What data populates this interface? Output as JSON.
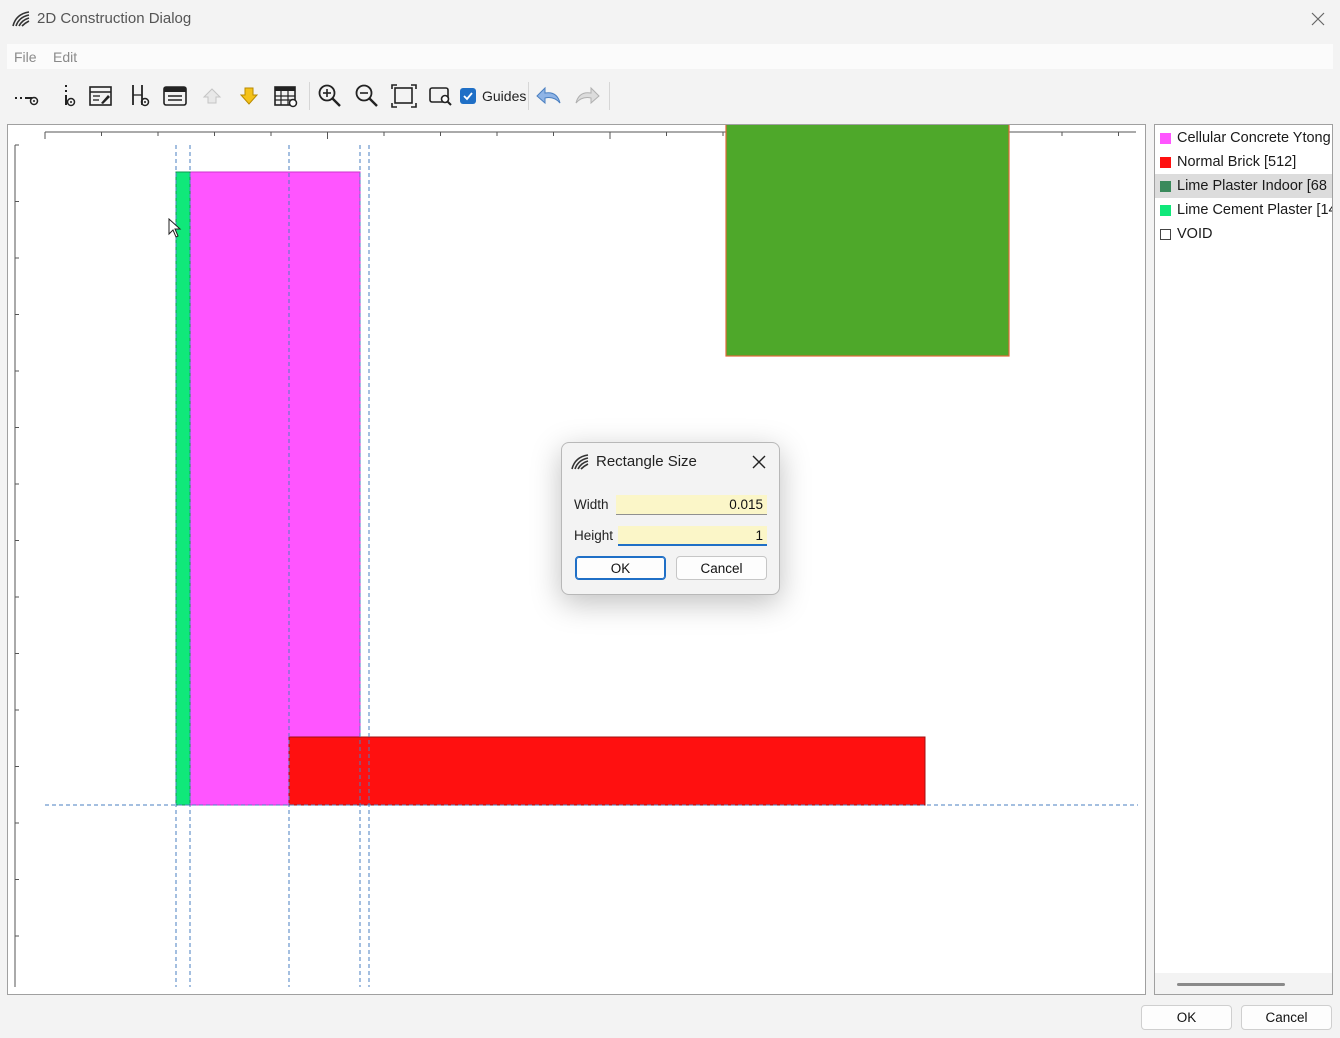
{
  "window": {
    "title": "2D Construction Dialog"
  },
  "menu": {
    "items": [
      "File",
      "Edit"
    ]
  },
  "toolbar": {
    "guides_label": "Guides",
    "guides_checked": true,
    "icons": [
      "add-horizontal-line-icon",
      "add-vertical-line-icon",
      "edit-table-icon",
      "split-icon",
      "properties-icon",
      "move-up-icon",
      "move-down-icon",
      "grid-table-icon",
      "zoom-in-icon",
      "zoom-out-icon",
      "zoom-fit-icon",
      "zoom-select-icon",
      "undo-icon",
      "redo-icon"
    ]
  },
  "legend": {
    "items": [
      {
        "label": "Cellular Concrete Ytong [",
        "color": "#ff55ff",
        "selected": false
      },
      {
        "label": "Normal Brick [512]",
        "color": "#ff1010",
        "selected": false
      },
      {
        "label": "Lime Plaster Indoor [68",
        "color": "#3a8a5c",
        "selected": true
      },
      {
        "label": "Lime Cement Plaster [14",
        "color": "#10e87a",
        "selected": false
      },
      {
        "label": "VOID",
        "color": "#ffffff",
        "selected": false
      }
    ]
  },
  "colors": {
    "cellular_concrete": "#ff55ff",
    "normal_brick": "#ff1010",
    "lime_cement_plaster": "#10e87a",
    "green_block": "#4ea82a",
    "green_block_border": "#e06a3a",
    "guide_line": "#4a7fc0"
  },
  "dialog": {
    "title": "Rectangle Size",
    "width_label": "Width",
    "width_value": "0.015",
    "height_label": "Height",
    "height_value": "1",
    "ok_label": "OK",
    "cancel_label": "Cancel"
  },
  "footer": {
    "ok_label": "OK",
    "cancel_label": "Cancel"
  }
}
